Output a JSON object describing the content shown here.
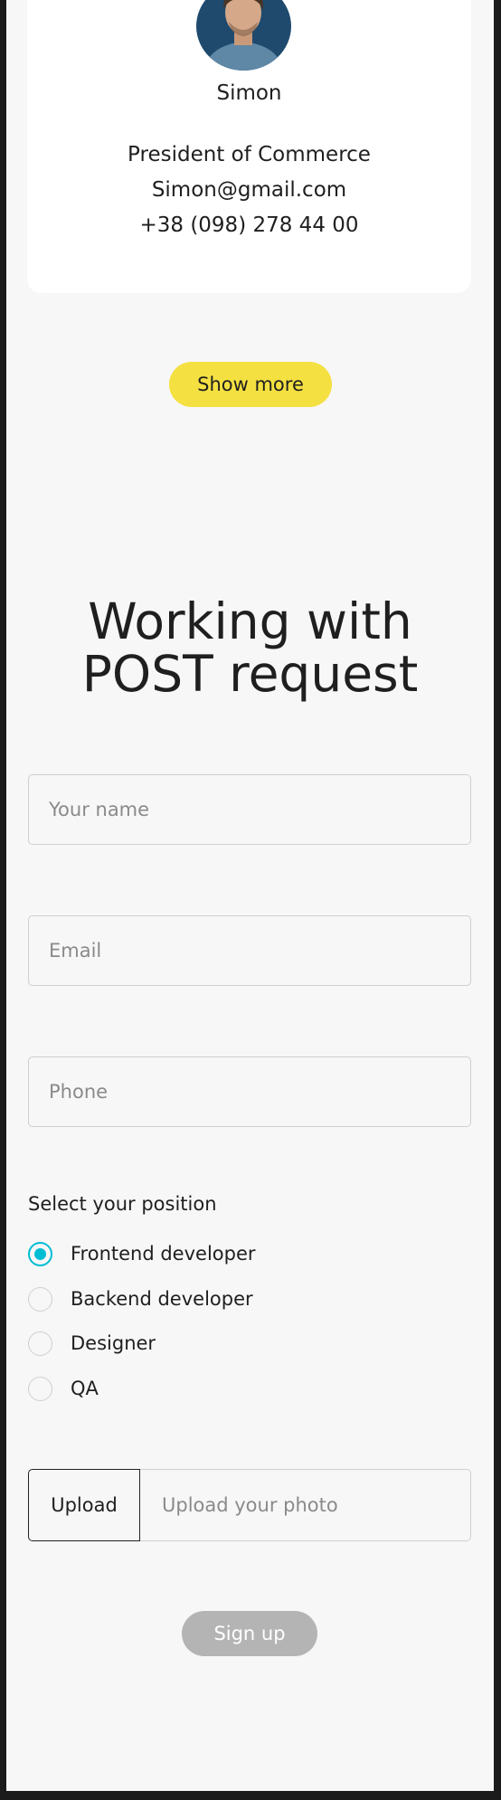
{
  "user_card": {
    "name": "Simon",
    "position": "President of Commerce",
    "email": "Simon@gmail.com",
    "phone": "+38 (098) 278 44 00"
  },
  "show_more_label": "Show more",
  "form": {
    "heading_line1": "Working with",
    "heading_line2": "POST request",
    "name_placeholder": "Your name",
    "email_placeholder": "Email",
    "phone_placeholder": "Phone",
    "position_label": "Select your position",
    "positions": [
      {
        "label": "Frontend developer",
        "checked": true
      },
      {
        "label": "Backend developer",
        "checked": false
      },
      {
        "label": "Designer",
        "checked": false
      },
      {
        "label": "QA",
        "checked": false
      }
    ],
    "upload_button_label": "Upload",
    "upload_placeholder": "Upload your photo",
    "signup_label": "Sign up"
  },
  "colors": {
    "primary_yellow": "#f4e041",
    "accent_cyan": "#00bdd3",
    "disabled_grey": "#b4b4b4",
    "background": "#f7f7f7"
  }
}
